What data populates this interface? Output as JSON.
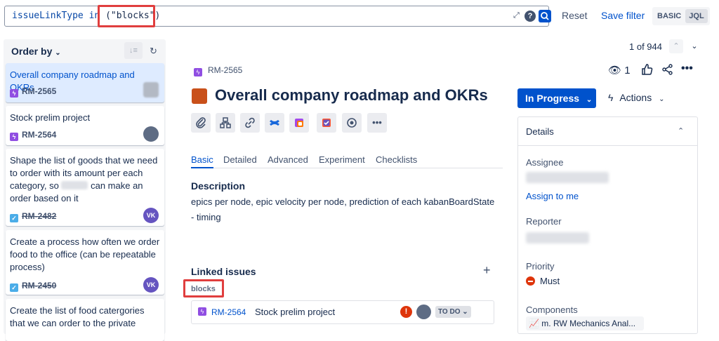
{
  "search": {
    "jql_field": "issueLinkType",
    "jql_operator": "in",
    "jql_value": "(\"blocks\")",
    "reset_label": "Reset",
    "save_filter_label": "Save filter",
    "mode_basic": "BASIC",
    "mode_jql": "JQL"
  },
  "list": {
    "order_by_label": "Order by",
    "cards": [
      {
        "title": "Overall company roadmap and OKRs",
        "key": "RM-2565",
        "type": "epic",
        "done": false,
        "selected": true
      },
      {
        "title": "Stock prelim project",
        "key": "RM-2564",
        "type": "epic",
        "done": false
      },
      {
        "title_a": "Shape the list of goods that we need to order with its amount per each category, so",
        "title_b": "can make an order based on it",
        "key": "RM-2482",
        "type": "task",
        "done": true,
        "assignee": "VK"
      },
      {
        "title": "Create a process how often we order food to the office (can be repeatable process)",
        "key": "RM-2450",
        "type": "task",
        "done": true,
        "assignee": "VK"
      },
      {
        "title": "Create the list of food catergories that we can order to the private"
      }
    ]
  },
  "issue": {
    "breadcrumb_key": "RM-2565",
    "title": "Overall company roadmap and OKRs",
    "tabs": [
      "Basic",
      "Detailed",
      "Advanced",
      "Experiment",
      "Checklists"
    ],
    "description_heading": "Description",
    "description": "epics per node, epic velocity per node, prediction of each kabanBoardState - timing",
    "linked_heading": "Linked issues",
    "link_type": "blocks",
    "linked": {
      "key": "RM-2564",
      "summary": "Stock prelim project",
      "status": "TO DO"
    }
  },
  "header": {
    "pager": "1 of 944",
    "watchers": "1",
    "status_label": "In Progress",
    "actions_label": "Actions"
  },
  "details": {
    "title": "Details",
    "assignee_label": "Assignee",
    "assign_to_me": "Assign to me",
    "reporter_label": "Reporter",
    "priority_label": "Priority",
    "priority_value": "Must",
    "components_label": "Components",
    "component_value": "m. RW Mechanics Anal..."
  },
  "colors": {
    "accent": "#0052cc",
    "epic": "#904ee2",
    "task": "#4bade8",
    "highlight": "#e03e3e",
    "title_square": "#c9501a"
  }
}
